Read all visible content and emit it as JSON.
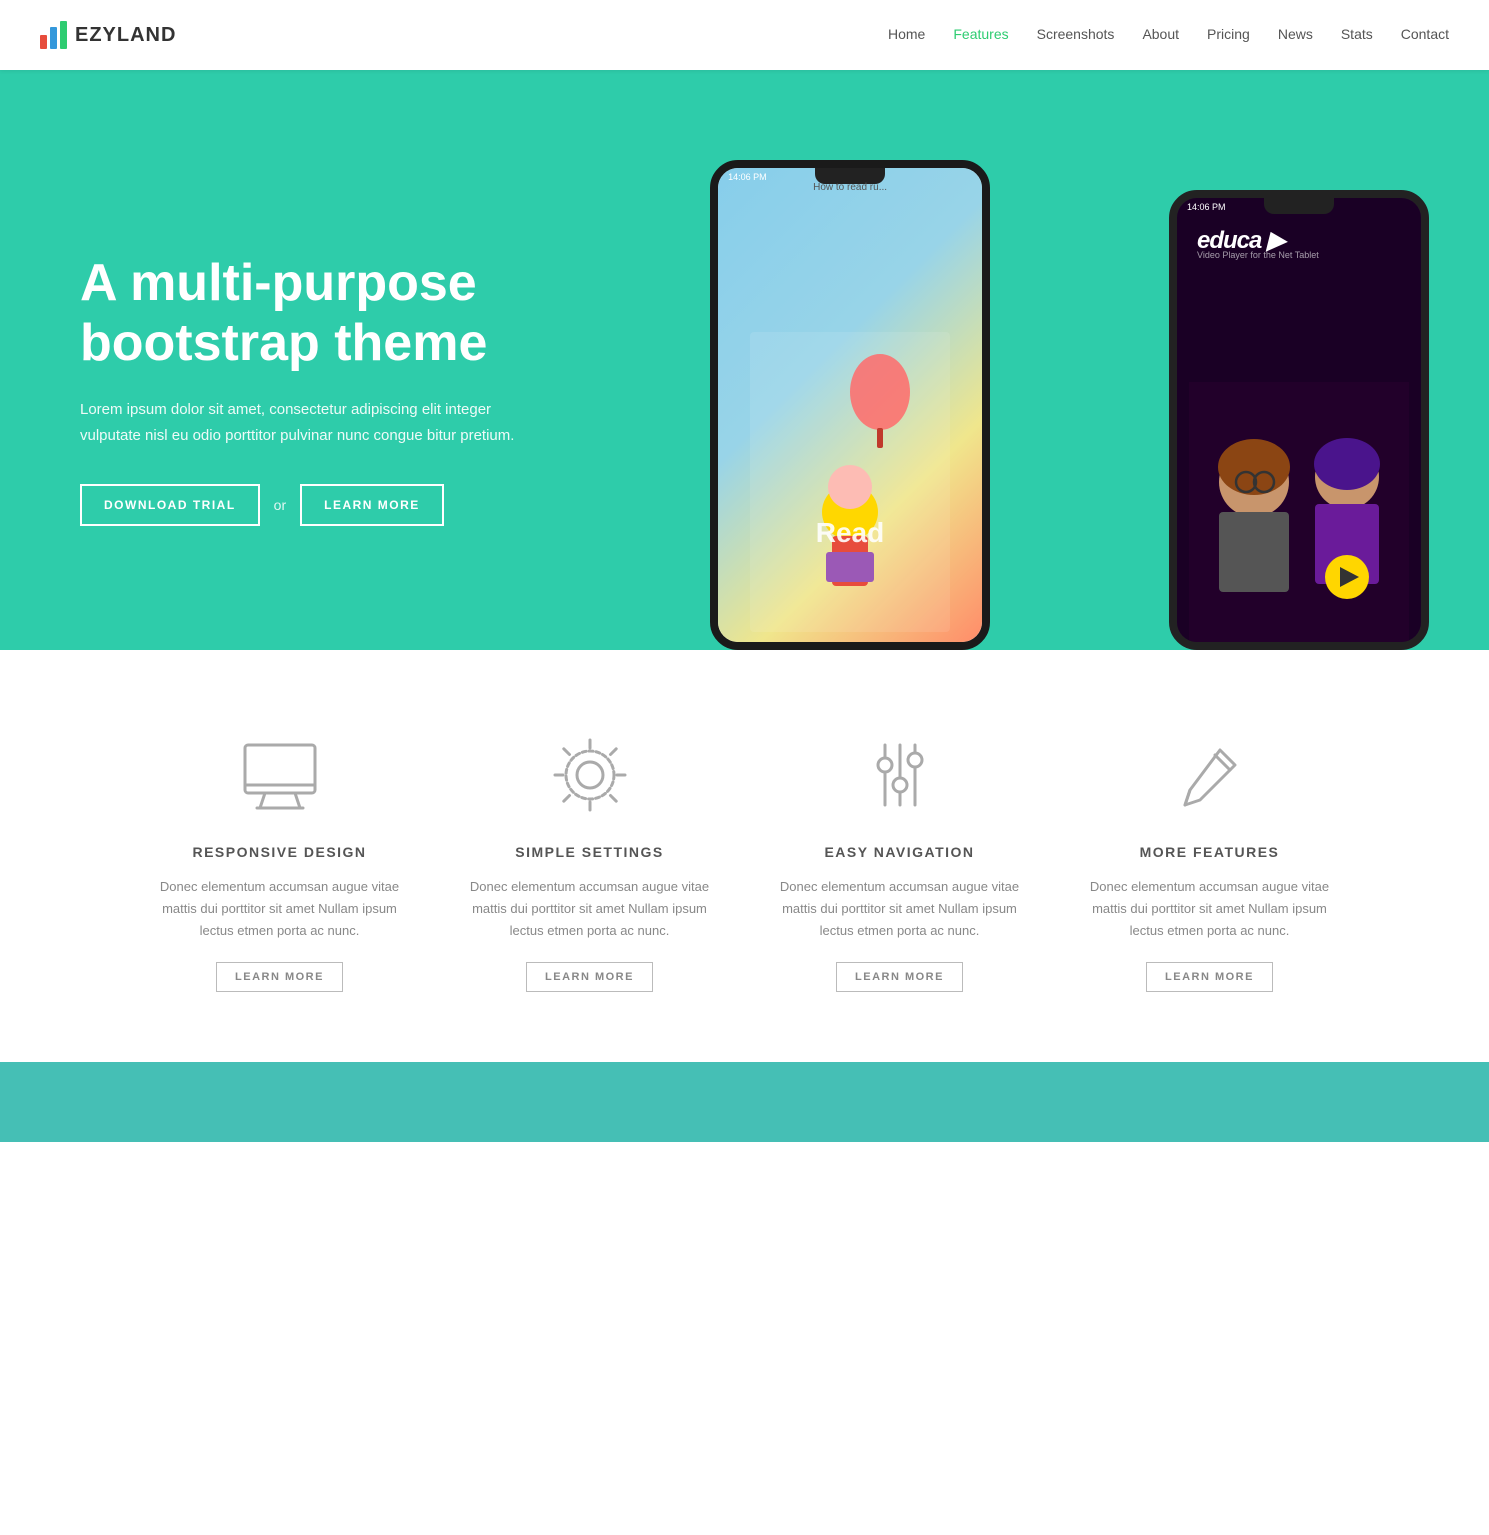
{
  "brand": {
    "name": "EZYLAND"
  },
  "nav": {
    "links": [
      {
        "label": "Home",
        "active": false
      },
      {
        "label": "Features",
        "active": true
      },
      {
        "label": "Screenshots",
        "active": false
      },
      {
        "label": "About",
        "active": false
      },
      {
        "label": "Pricing",
        "active": false
      },
      {
        "label": "News",
        "active": false
      },
      {
        "label": "Stats",
        "active": false
      },
      {
        "label": "Contact",
        "active": false
      }
    ]
  },
  "hero": {
    "title": "A multi-purpose bootstrap theme",
    "description": "Lorem ipsum dolor sit amet, consectetur adipiscing elit integer vulputate nisl eu odio porttitor pulvinar nunc congue bitur pretium.",
    "btn_download": "DOWNLOAD TRIAL",
    "btn_or": "or",
    "btn_learn": "LEARN MORE"
  },
  "features": [
    {
      "icon": "monitor",
      "title": "RESPONSIVE DESIGN",
      "description": "Donec elementum accumsan augue vitae mattis dui porttitor sit amet Nullam ipsum lectus etmen porta ac nunc.",
      "btn": "LEARN MORE"
    },
    {
      "icon": "settings",
      "title": "SIMPLE SETTINGS",
      "description": "Donec elementum accumsan augue vitae mattis dui porttitor sit amet Nullam ipsum lectus etmen porta ac nunc.",
      "btn": "LEARN MORE"
    },
    {
      "icon": "sliders",
      "title": "EASY NAVIGATION",
      "description": "Donec elementum accumsan augue vitae mattis dui porttitor sit amet Nullam ipsum lectus etmen porta ac nunc.",
      "btn": "LEARN MORE"
    },
    {
      "icon": "pencil",
      "title": "MORE FEATURES",
      "description": "Donec elementum accumsan augue vitae mattis dui porttitor sit amet Nullam ipsum lectus etmen porta ac nunc.",
      "btn": "LEARN MORE"
    }
  ]
}
